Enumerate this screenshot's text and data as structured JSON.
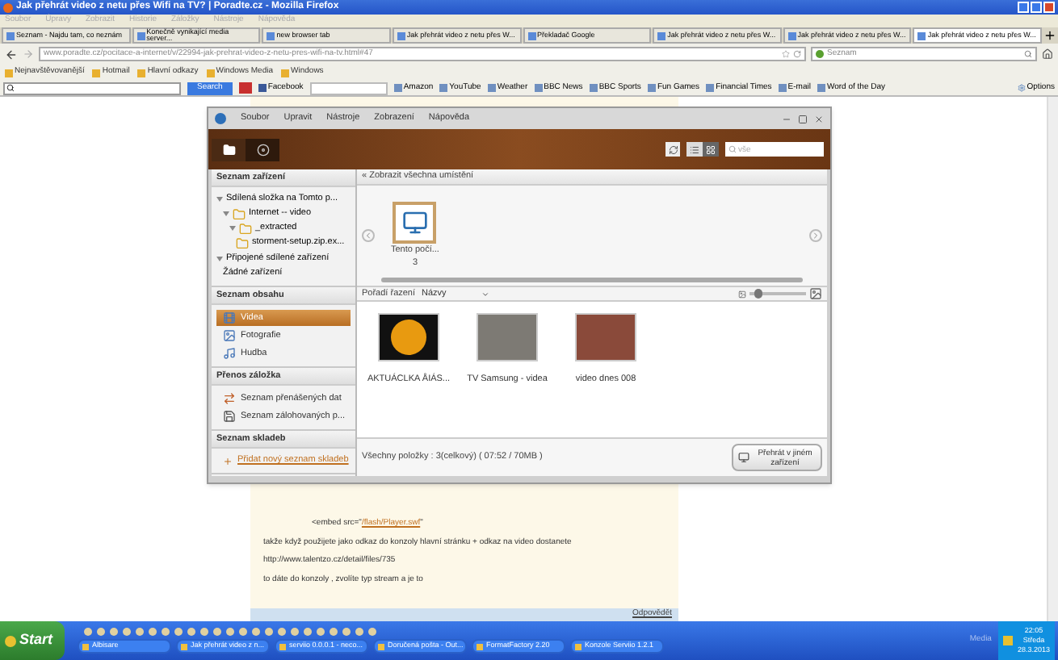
{
  "browser": {
    "title": "Jak přehrát video z netu přes Wifi na TV? | Poradte.cz - Mozilla Firefox",
    "menu": [
      "Soubor",
      "Úpravy",
      "Zobrazit",
      "Historie",
      "Záložky",
      "Nástroje",
      "Nápověda"
    ],
    "tabs": [
      {
        "label": "Seznam - Najdu tam, co neznám",
        "selected": false
      },
      {
        "label": "Konečně vynikající media server...",
        "selected": false
      },
      {
        "label": "new browser tab",
        "selected": false
      },
      {
        "label": "Jak přehrát video z netu přes W...",
        "selected": false
      },
      {
        "label": "Překladač Google",
        "selected": false
      },
      {
        "label": "Jak přehrát video z netu přes W...",
        "selected": false
      },
      {
        "label": "Jak přehrát video z netu přes W...",
        "selected": false
      },
      {
        "label": "Jak přehrát video z netu přes W...",
        "selected": true
      }
    ],
    "address": "www.poradte.cz/pocitace-a-internet/v/22994-jak-prehrat-video-z-netu-pres-wifi-na-tv.html#47",
    "search_engine": "Seznam",
    "bookmarks": [
      "Nejnavštěvovanější",
      "Hotmail",
      "Hlavní odkazy",
      "Windows Media",
      "Windows"
    ],
    "toolbar": {
      "search_button": "Search",
      "facebook": "Facebook",
      "items": [
        "Amazon",
        "YouTube",
        "Weather",
        "BBC News",
        "BBC Sports",
        "Fun Games",
        "Financial Times",
        "E-mail",
        "Word of the Day"
      ],
      "options": "Options"
    }
  },
  "app": {
    "menu": [
      "Soubor",
      "Upravit",
      "Nástroje",
      "Zobrazení",
      "Nápověda"
    ],
    "search_placeholder": "vše",
    "view_modes": [
      {
        "kind": "list",
        "selected": false
      },
      {
        "kind": "grid",
        "selected": true
      }
    ],
    "sidebar": [
      {
        "title": "Seznam zařízení",
        "kind": "tree",
        "items": [
          {
            "label": "Sdílená složka na Tomto p...",
            "kind": "text",
            "expanded": true,
            "children": [
              {
                "label": "Internet -- video",
                "kind": "folder",
                "expanded": true,
                "children": [
                  {
                    "label": "_extracted",
                    "kind": "folder",
                    "expanded": true,
                    "children": [
                      {
                        "label": "storment-setup.zip.ex...",
                        "kind": "folder"
                      }
                    ]
                  }
                ]
              }
            ]
          },
          {
            "label": "Připojené sdílené zařízení",
            "kind": "text",
            "expanded": true,
            "children": [
              {
                "label": "Žádné zařízení",
                "kind": "text"
              }
            ]
          }
        ]
      },
      {
        "title": "Seznam obsahu",
        "kind": "list",
        "items": [
          {
            "label": "Videa",
            "kind": "video",
            "selected": true
          },
          {
            "label": "Fotografie",
            "kind": "photo",
            "selected": false
          },
          {
            "label": "Hudba",
            "kind": "music",
            "selected": false
          }
        ]
      },
      {
        "title": "Přenos záložka",
        "kind": "list",
        "items": [
          {
            "label": "Seznam přenášených dat",
            "kind": "transfer",
            "selected": false
          },
          {
            "label": "Seznam zálohovaných p...",
            "kind": "backup",
            "selected": false
          }
        ]
      },
      {
        "title": "Seznam skladeb",
        "kind": "link",
        "items": [
          {
            "label": "Přidat nový seznam skladeb",
            "kind": "add"
          }
        ]
      }
    ],
    "breadcrumb": "« Zobrazit všechna umístění",
    "devices": [
      {
        "label": "Tento počí...",
        "count": "3",
        "selected": true
      }
    ],
    "sort": {
      "label": "Pořadí řazení",
      "value": "Názvy"
    },
    "thumb_size": {
      "level": 0.15
    },
    "videos": [
      {
        "title": "AKTUÁCLKA ÅIÁS...",
        "kind": "sun"
      },
      {
        "title": "TV Samsung - videa",
        "kind": "room"
      },
      {
        "title": "video dnes 008",
        "kind": "people"
      }
    ],
    "status": "Všechny položky : 3(celkový) ( 07:52 / 70MB )",
    "play_button": "Přehrát v jiném zařízení"
  },
  "page": {
    "embed_prefix": "<embed src=\"",
    "embed_link": "/flash/Player.swf",
    "embed_suffix": "\"",
    "lines": [
      "takže když použijete jako odkaz do konzoly hlavní stránku + odkaz na video dostanete",
      "http://www.talentzo.cz/detail/files/735",
      "to dáte do konzoly , zvolíte typ stream a je to"
    ],
    "reply": "Odpovědět"
  },
  "taskbar": {
    "start": "Start",
    "tasks": [
      "Albisare",
      "Jak přehrát video z n...",
      "serviio 0.0.0.1 - neco...",
      "Doručená pošta - Out...",
      "FormatFactory 2.20",
      "Konzole Serviio 1.2.1"
    ],
    "tray_label": "Media",
    "time": "22:05",
    "day": "Středa",
    "date": "28.3.2013"
  }
}
